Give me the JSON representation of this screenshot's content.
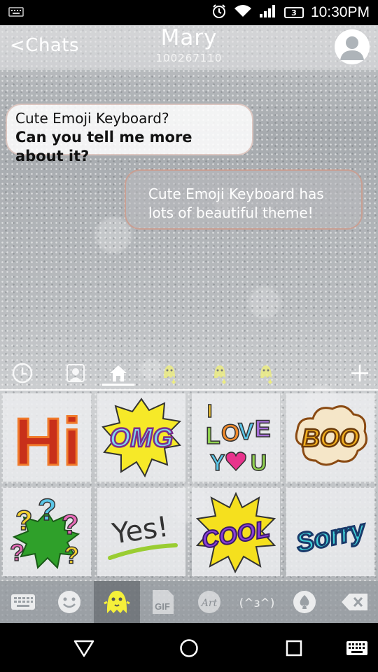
{
  "status_bar": {
    "time": "10:30PM",
    "battery_level": "3",
    "icons": [
      "keyboard-icon",
      "alarm-icon",
      "wifi-icon",
      "signal-icon",
      "battery-icon"
    ]
  },
  "header": {
    "back_label": "Chats",
    "contact_name": "Mary",
    "contact_id": "100267110",
    "avatar_icon": "person-icon"
  },
  "messages": [
    {
      "direction": "incoming",
      "lines": [
        "Cute Emoji Keyboard?",
        "Can you tell me more about it?"
      ]
    },
    {
      "direction": "outgoing",
      "lines": [
        "Cute Emoji Keyboard has",
        "lots of beautiful theme!"
      ]
    }
  ],
  "keyboard_tabs": [
    "clock-icon",
    "person-icon",
    "home-icon",
    "ghost-download-icon",
    "ghost-download-icon",
    "ghost-download-icon",
    "plus-icon"
  ],
  "stickers": [
    {
      "name": "hi-sticker",
      "text": "Hi"
    },
    {
      "name": "omg-sticker",
      "text": "OMG"
    },
    {
      "name": "i-love-you-sticker",
      "text": "I LOVE YOU"
    },
    {
      "name": "boo-sticker",
      "text": "BOO"
    },
    {
      "name": "question-marks-sticker",
      "text": "???"
    },
    {
      "name": "yes-sticker",
      "text": "Yes!"
    },
    {
      "name": "cool-sticker",
      "text": "COOL"
    },
    {
      "name": "sorry-sticker",
      "text": "Sorry"
    }
  ],
  "keyboard_bar": {
    "items": [
      "keyboard-icon",
      "smiley-icon",
      "ghost-icon",
      "gif-icon",
      "art-icon",
      "kaomoji-icon",
      "spade-icon",
      "backspace-icon"
    ],
    "gif_label": "GIF",
    "art_label": "Art",
    "kaomoji_label": "(^з^)",
    "active": "ghost-icon"
  },
  "nav_bar": [
    "back-icon",
    "home-icon",
    "recents-icon",
    "keyboard-icon"
  ],
  "colors": {
    "accent_active": "#5a5f64",
    "ghost": "#f5f03a"
  }
}
